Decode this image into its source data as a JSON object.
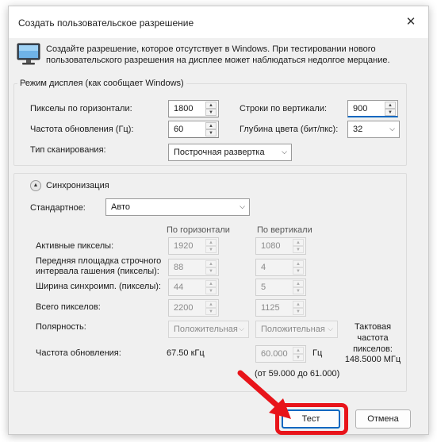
{
  "window": {
    "title": "Создать пользовательское разрешение",
    "close_glyph": "✕"
  },
  "intro_text": "Создайте разрешение, которое отсутствует в Windows. При тестировании нового пользовательского разрешения на дисплее может наблюдаться недолгое мерцание.",
  "display_mode": {
    "legend": "Режим дисплея (как сообщает Windows)",
    "h_pixels_label": "Пикселы по горизонтали:",
    "h_pixels_value": "1800",
    "v_lines_label": "Строки по вертикали:",
    "v_lines_value": "900",
    "refresh_label": "Частота обновления (Гц):",
    "refresh_value": "60",
    "color_depth_label": "Глубина цвета (бит/пкс):",
    "color_depth_value": "32",
    "scan_label": "Тип сканирования:",
    "scan_value": "Построчная развертка"
  },
  "sync": {
    "title": "Синхронизация",
    "standard_label": "Стандартное:",
    "standard_value": "Авто",
    "col_horizontal": "По горизонтали",
    "col_vertical": "По вертикали",
    "rows": [
      {
        "label": "Активные пикселы:",
        "h": "1920",
        "v": "1080"
      },
      {
        "label": "Передняя площадка строчного интервала гашения (пикселы):",
        "h": "88",
        "v": "4"
      },
      {
        "label": "Ширина синхроимп. (пикселы):",
        "h": "44",
        "v": "5"
      },
      {
        "label": "Всего пикселов:",
        "h": "2200",
        "v": "1125"
      }
    ],
    "polarity_label": "Полярность:",
    "polarity_h": "Положительная",
    "polarity_v": "Положительная",
    "refresh_label": "Частота обновления:",
    "refresh_h_value": "67.50 кГц",
    "refresh_v_value": "60.000",
    "refresh_v_unit": "Гц",
    "refresh_range": "(от 59.000 до 61.000)",
    "pixel_clock_label": "Тактовая частота пикселов:",
    "pixel_clock_value": "148.5000 МГц"
  },
  "buttons": {
    "test": "Тест",
    "cancel": "Отмена"
  },
  "colors": {
    "accent": "#0067c0",
    "highlight": "#e8141a"
  }
}
